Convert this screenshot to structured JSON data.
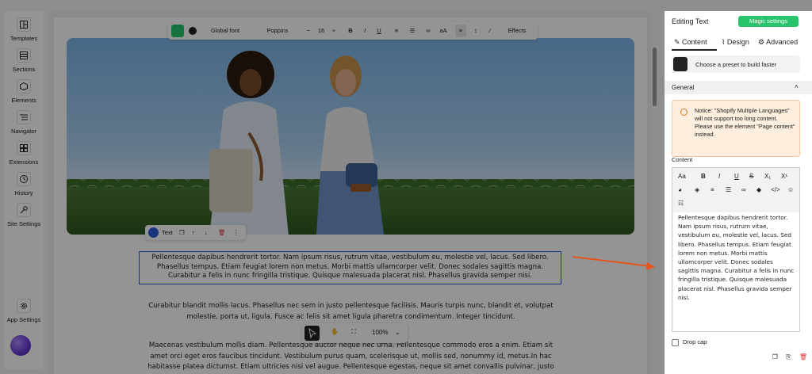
{
  "sidebar": {
    "items": [
      {
        "label": "Templates",
        "icon": "templates-icon"
      },
      {
        "label": "Sections",
        "icon": "sections-icon"
      },
      {
        "label": "Elements",
        "icon": "elements-icon"
      },
      {
        "label": "Navigator",
        "icon": "navigator-icon"
      },
      {
        "label": "Extensions",
        "icon": "extensions-icon"
      },
      {
        "label": "History",
        "icon": "history-icon"
      },
      {
        "label": "Site Settings",
        "icon": "site-settings-icon"
      }
    ],
    "app_settings": "App Settings"
  },
  "toolbar": {
    "global_font": "Global font",
    "font": "Poppins",
    "minus": "−",
    "size": "16",
    "plus": "+",
    "bold": "B",
    "italic": "I",
    "underline": "U",
    "case": "aA",
    "effects": "Effects"
  },
  "element_toolbar": {
    "label": "Text"
  },
  "canvas": {
    "selected_text": "Pellentesque dapibus hendrerit tortor. Nam ipsum risus, rutrum vitae, vestibulum eu, molestie vel, lacus. Sed libero. Phasellus tempus. Etiam feugiat lorem non metus. Morbi mattis ullamcorper velit. Donec sodales sagittis magna. Curabitur a felis in nunc fringilla tristique. Quisque malesuada placerat nisl. Phasellus gravida semper nisi.",
    "paragraph_2": "Curabitur blandit mollis lacus. Phasellus nec sem in justo pellentesque facilisis. Mauris turpis nunc, blandit et, volutpat molestie, porta ut, ligula. Fusce ac felis sit amet ligula pharetra condimentum. Integer tincidunt.",
    "paragraph_3": "Maecenas vestibulum mollis diam. Pellentesque auctor neque nec urna. Pellentesque commodo eros a enim. Etiam sit amet orci eget eros faucibus tincidunt. Vestibulum purus quam, scelerisque ut, mollis sed, nonummy id, metus.In hac habitasse platea dictumst. Etiam ultricies nisi vel augue. Pellentesque egestas, neque sit amet convallis pulvinar, justo"
  },
  "bottom_tools": {
    "zoom": "100%"
  },
  "panel": {
    "title": "Editing Text",
    "magic": "Magic settings",
    "tabs": [
      "Content",
      "Design",
      "Advanced"
    ],
    "preset": "Choose a preset to build faster",
    "section": "General",
    "notice": "Notice: \"Shopify Multiple Languages\" will not support too long content. Please use the element \"Page content\" instead.",
    "content_label": "Content",
    "editor_text": "Pellentesque dapibus hendrerit tortor. Nam ipsum risus, rutrum vitae, vestibulum eu, molestie vel, lacus. Sed libero. Phasellus tempus. Etiam feugiat lorem non metus. Morbi mattis ullamcorper velit. Donec sodales sagittis magna. Curabitur a felis in nunc fringilla tristique. Quisque malesuada placerat nisl. Phasellus gravida semper nisi.",
    "dropcap": "Drop cap",
    "editor_tools": {
      "size": "Aa",
      "bold": "B",
      "italic": "I",
      "underline": "U",
      "strike": "S",
      "sub": "X₁",
      "sup": "X¹"
    }
  },
  "colors": {
    "accent_green": "#27c46b",
    "selection_blue": "#2b5bd9",
    "arrow_orange": "#e8541e"
  }
}
